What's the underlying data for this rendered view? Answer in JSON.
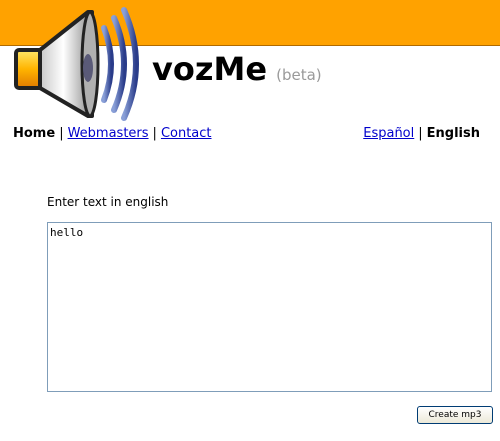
{
  "header": {
    "title": "vozMe",
    "subtitle": "(beta)",
    "logo_icon": "speaker-icon",
    "bar_color": "#ffa200"
  },
  "nav": {
    "home": "Home",
    "webmasters": "Webmasters",
    "contact": "Contact",
    "lang_es": "Español",
    "lang_en": "English",
    "separator": "|"
  },
  "form": {
    "label": "Enter text in english",
    "text_value": "hello",
    "submit_label": "Create mp3"
  },
  "colors": {
    "link": "#0000cc",
    "subtitle": "#9a9a9a"
  }
}
